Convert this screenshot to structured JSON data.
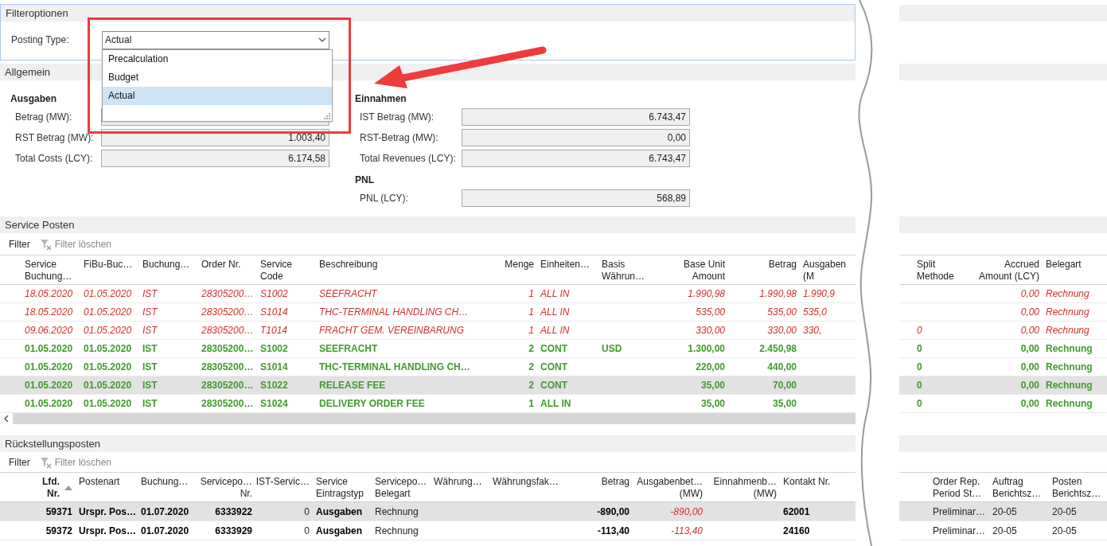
{
  "filter_options": {
    "title": "Filteroptionen",
    "posting_type": {
      "label": "Posting Type:",
      "value": "Actual",
      "expanded": true,
      "options": [
        {
          "label": "Precalculation",
          "selected": false
        },
        {
          "label": "Budget",
          "selected": false
        },
        {
          "label": "Actual",
          "selected": true
        }
      ]
    }
  },
  "general": {
    "title": "Allgemein",
    "expenses": {
      "title": "Ausgaben",
      "fields": [
        {
          "label": "Betrag (MW):"
        },
        {
          "label": "RST Betrag (MW):",
          "value": "1.003,40"
        },
        {
          "label": "Total Costs (LCY):",
          "value": "6.174,58"
        }
      ]
    },
    "revenues": {
      "title": "Einnahmen",
      "fields": [
        {
          "label": "IST Betrag (MW):",
          "value": "6.743,47"
        },
        {
          "label": "RST-Betrag (MW):",
          "value": "0,00"
        },
        {
          "label": "Total Revenues (LCY):",
          "value": "6.743,47"
        }
      ]
    },
    "pnl": {
      "title": "PNL",
      "fields": [
        {
          "label": "PNL (LCY):",
          "value": "568,89"
        }
      ]
    }
  },
  "service_entries": {
    "title": "Service Posten",
    "toolbar": {
      "filter": "Filter",
      "clear_filter": "Filter löschen"
    },
    "columns": [
      {
        "lines": [
          "Service",
          "Buchung…"
        ]
      },
      {
        "lines": [
          "FiBu-Buc…"
        ]
      },
      {
        "lines": [
          "Buchung…"
        ]
      },
      {
        "lines": [
          "Order Nr."
        ]
      },
      {
        "lines": [
          "Service",
          "Code"
        ]
      },
      {
        "lines": [
          "Beschreibung"
        ]
      },
      {
        "lines": [
          "Menge"
        ]
      },
      {
        "lines": [
          "Einheiten…"
        ]
      },
      {
        "lines": [
          "Basis",
          "Währun…"
        ]
      },
      {
        "lines": [
          "Base Unit",
          "Amount"
        ]
      },
      {
        "lines": [
          "Betrag"
        ]
      },
      {
        "lines": [
          "Ausgaben",
          "(M"
        ]
      }
    ],
    "right_columns": [
      {
        "lines": [
          "Split",
          "Methode"
        ]
      },
      {
        "lines": [
          "Accrued",
          "Amount (LCY)"
        ]
      },
      {
        "lines": [
          "Belegart"
        ]
      }
    ],
    "rows": [
      {
        "kind": "planned",
        "selected": false,
        "cells": [
          "18.05.2020",
          "01.05.2020",
          "IST",
          "28305200…",
          "S1002",
          "SEEFRACHT",
          "1",
          "ALL IN",
          null,
          "1.990,98",
          "1.990,98",
          "1.990,9"
        ],
        "right_cells": [
          null,
          "0,00",
          "Rechnung"
        ]
      },
      {
        "kind": "planned",
        "selected": false,
        "cells": [
          "18.05.2020",
          "01.05.2020",
          "IST",
          "28305200…",
          "S1014",
          "THC-TERMINAL HANDLING CH…",
          "1",
          "ALL IN",
          null,
          "535,00",
          "535,00",
          "535,0"
        ],
        "right_cells": [
          null,
          "0,00",
          "Rechnung"
        ]
      },
      {
        "kind": "planned",
        "selected": false,
        "cells": [
          "09.06.2020",
          "01.05.2020",
          "IST",
          "28305200…",
          "T1014",
          "FRACHT GEM. VEREINBARUNG",
          "1",
          "ALL IN",
          null,
          "330,00",
          "330,00",
          "330,"
        ],
        "right_cells": [
          "0",
          "0,00",
          "Rechnung"
        ]
      },
      {
        "kind": "actual",
        "selected": false,
        "cells": [
          "01.05.2020",
          "01.05.2020",
          "IST",
          "28305200…",
          "S1002",
          "SEEFRACHT",
          "2",
          "CONT",
          "USD",
          "1.300,00",
          "2.450,98",
          null
        ],
        "right_cells": [
          "0",
          "0,00",
          "Rechnung"
        ]
      },
      {
        "kind": "actual",
        "selected": false,
        "cells": [
          "01.05.2020",
          "01.05.2020",
          "IST",
          "28305200…",
          "S1014",
          "THC-TERMINAL HANDLING CH…",
          "2",
          "CONT",
          null,
          "220,00",
          "440,00",
          null
        ],
        "right_cells": [
          "0",
          "0,00",
          "Rechnung"
        ]
      },
      {
        "kind": "actual",
        "selected": true,
        "cells": [
          "01.05.2020",
          "01.05.2020",
          "IST",
          "28305200…",
          "S1022",
          "RELEASE FEE",
          "2",
          "CONT",
          null,
          "35,00",
          "70,00",
          null
        ],
        "right_cells": [
          "0",
          "0,00",
          "Rechnung"
        ]
      },
      {
        "kind": "actual",
        "selected": false,
        "cells": [
          "01.05.2020",
          "01.05.2020",
          "IST",
          "28305200…",
          "S1024",
          "DELIVERY ORDER FEE",
          "1",
          "ALL IN",
          null,
          "35,00",
          "35,00",
          null
        ],
        "right_cells": [
          "0",
          "0,00",
          "Rechnung"
        ]
      }
    ]
  },
  "accrual_entries": {
    "title": "Rückstellungsposten",
    "toolbar": {
      "filter": "Filter",
      "clear_filter": "Filter löschen"
    },
    "columns": [
      {
        "lines": [
          "Lfd.",
          "Nr."
        ],
        "kind": "bold",
        "sorted": true
      },
      {
        "lines": [
          "Postenart"
        ],
        "kind": "bold",
        "sorted": false
      },
      {
        "lines": [
          "Buchung…"
        ],
        "kind": "bold",
        "sorted": false
      },
      {
        "lines": [
          "Servicepo…",
          "Nr."
        ],
        "kind": "bold",
        "sorted": false
      },
      {
        "lines": [
          "IST-Servic…"
        ],
        "kind": "plain",
        "sorted": false
      },
      {
        "lines": [
          "Service",
          "Eintragstyp"
        ],
        "kind": "bold",
        "sorted": false
      },
      {
        "lines": [
          "Servicepo…",
          "Belegart"
        ],
        "kind": "plain",
        "sorted": false
      },
      {
        "lines": [
          "Währung…"
        ],
        "kind": "plain",
        "sorted": false
      },
      {
        "lines": [
          "Währungsfak…"
        ],
        "kind": "plain",
        "sorted": false
      },
      {
        "lines": [
          "Betrag"
        ],
        "kind": "bold",
        "sorted": false
      },
      {
        "lines": [
          "Ausgabenbet…",
          "(MW)"
        ],
        "kind": "red",
        "sorted": false
      },
      {
        "lines": [
          "Einnahmenb…",
          "(MW)"
        ],
        "kind": "plain",
        "sorted": false
      },
      {
        "lines": [
          "Kontakt Nr."
        ],
        "kind": "bold",
        "sorted": false
      }
    ],
    "right_columns": [
      {
        "lines": [
          "Order Rep.",
          "Period St…"
        ],
        "kind": "plain",
        "sorted": false
      },
      {
        "lines": [
          "Auftrag",
          "Berichtsz…"
        ],
        "kind": "plain",
        "sorted": false
      },
      {
        "lines": [
          "Posten",
          "Berichtsz…"
        ],
        "kind": "plain",
        "sorted": false
      }
    ],
    "rows": [
      {
        "selected": true,
        "cells": [
          "59371",
          "Urspr. Pos…",
          "01.07.2020",
          "6333922",
          "0",
          "Ausgaben",
          "Rechnung",
          null,
          null,
          "-890,00",
          "-890,00",
          null,
          "62001"
        ],
        "right_cells": [
          "Preliminar…",
          "20-05",
          "20-05"
        ]
      },
      {
        "selected": false,
        "cells": [
          "59372",
          "Urspr. Pos…",
          "01.07.2020",
          "6333929",
          "0",
          "Ausgaben",
          "Rechnung",
          null,
          null,
          "-113,40",
          "-113,40",
          null,
          "24160"
        ],
        "right_cells": [
          "Preliminar…",
          "20-05",
          "20-05"
        ]
      }
    ]
  }
}
